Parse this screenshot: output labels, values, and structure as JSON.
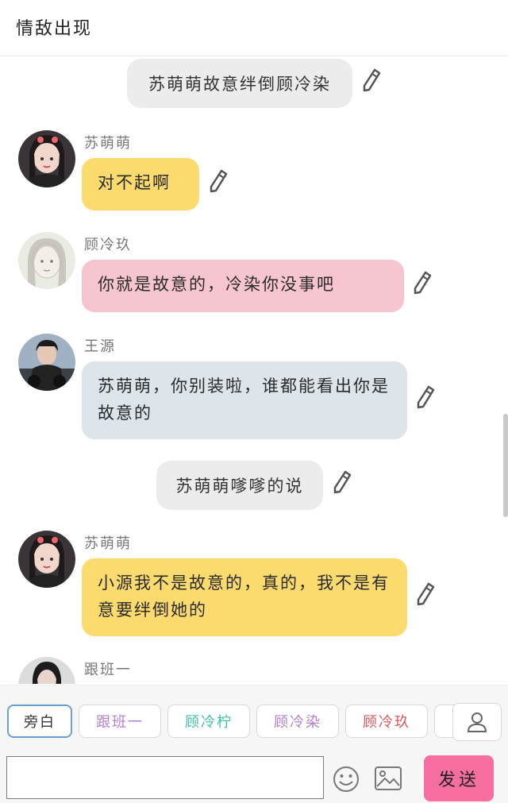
{
  "header": {
    "title": "情敌出现"
  },
  "messages": [
    {
      "type": "narration",
      "text": "苏萌萌故意绊倒顾冷染"
    },
    {
      "type": "chat",
      "name": "苏萌萌",
      "text": "对不起啊",
      "color": "#fbdb6e"
    },
    {
      "type": "chat",
      "name": "顾冷玖",
      "text": "你就是故意的，冷染你没事吧",
      "color": "#f7c5cf"
    },
    {
      "type": "chat",
      "name": "王源",
      "text": "苏萌萌，你别装啦，谁都能看出你是故意的",
      "color": "#dde4ea"
    },
    {
      "type": "narration",
      "text": "苏萌萌嗲嗲的说"
    },
    {
      "type": "chat",
      "name": "苏萌萌",
      "text": "小源我不是故意的，真的，我不是有意要绊倒她的",
      "color": "#fbdb6e"
    },
    {
      "type": "chat",
      "name": "跟班一",
      "text": ""
    }
  ],
  "roles": [
    {
      "label": "旁白",
      "color": "#333333",
      "active": true
    },
    {
      "label": "跟班一",
      "color": "#b27fd3"
    },
    {
      "label": "顾冷柠",
      "color": "#3cbfa9"
    },
    {
      "label": "顾冷染",
      "color": "#b27fd3"
    },
    {
      "label": "顾冷玖",
      "color": "#e0555a"
    }
  ],
  "composer": {
    "input_value": "",
    "send_label": "发送"
  },
  "icons": {
    "edit": "pencil-icon",
    "profile": "person-icon",
    "emoji": "smiley-icon",
    "image": "image-icon"
  }
}
